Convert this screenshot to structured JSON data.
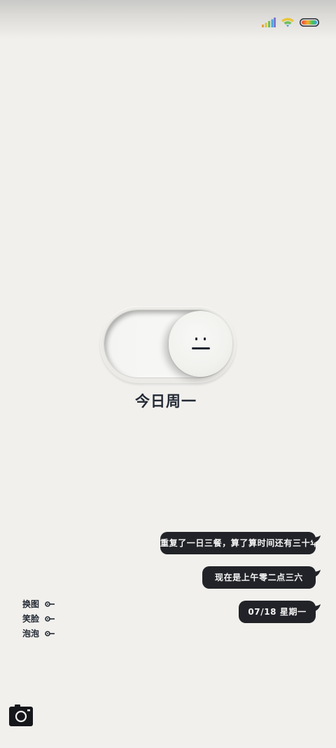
{
  "status_bar": {
    "icons": [
      "signal-bars-icon",
      "wifi-icon",
      "battery-icon"
    ],
    "battery_colors": [
      "#e8453c",
      "#f5b12a",
      "#46c35b",
      "#3aa0e8"
    ]
  },
  "toggle": {
    "state": "on",
    "face": "neutral-face-icon"
  },
  "day_label": "今日周一",
  "bubbles": [
    {
      "text": "重复了一日三餐，算了算时间还有三十年"
    },
    {
      "text": "现在是上午零二点三六"
    },
    {
      "text": "07/18 星期一"
    }
  ],
  "menu": [
    {
      "label": "换图",
      "icon": "key-icon"
    },
    {
      "label": "笑脸",
      "icon": "key-icon"
    },
    {
      "label": "泡泡",
      "icon": "key-icon"
    }
  ],
  "camera": {
    "icon": "camera-icon"
  },
  "colors": {
    "background": "#f1f0ed",
    "bubble": "#222328",
    "text_dark": "#222933"
  }
}
